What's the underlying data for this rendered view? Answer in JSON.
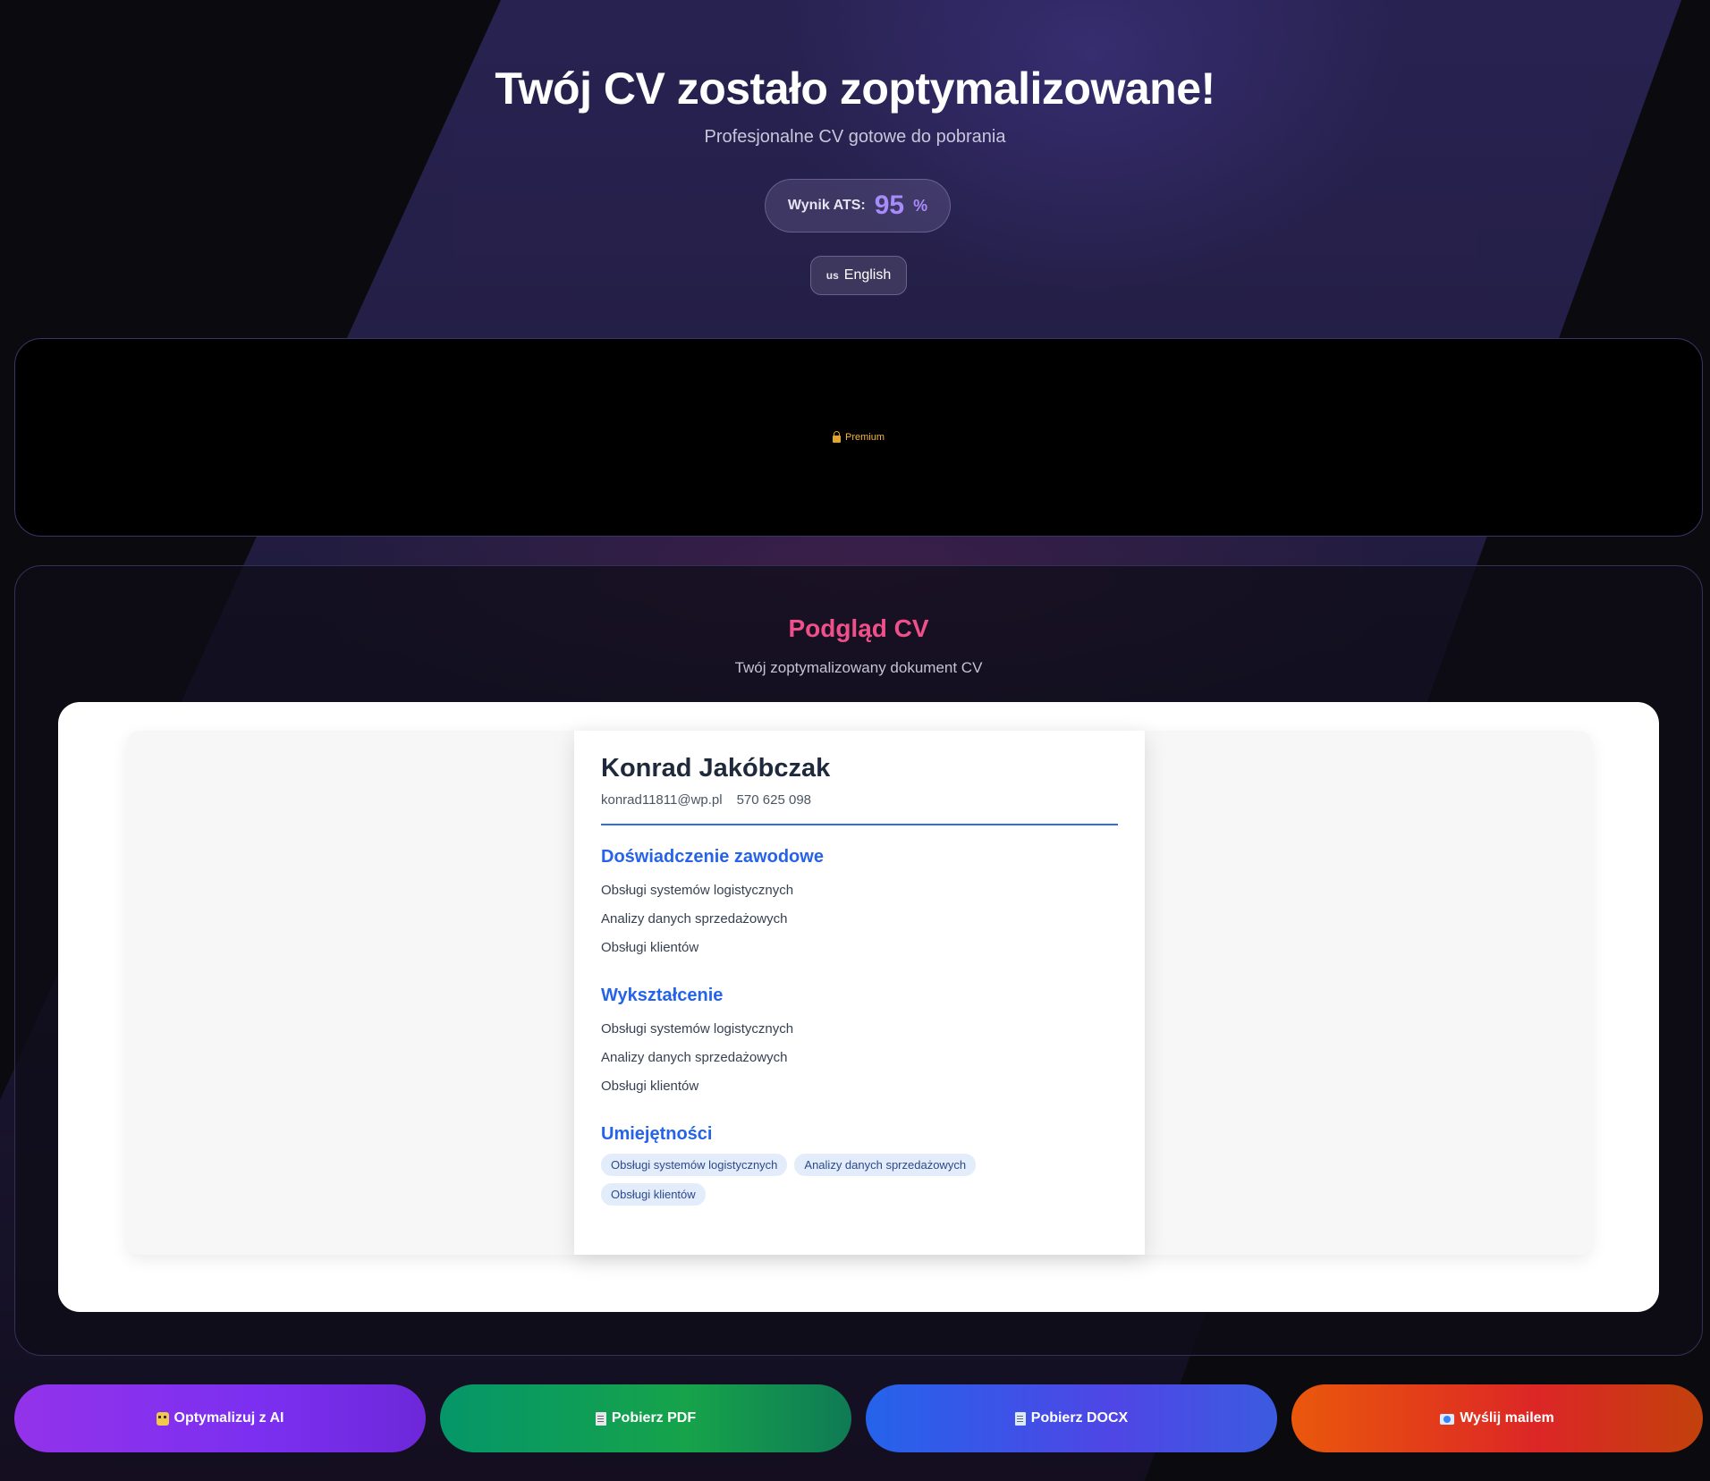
{
  "header": {
    "title": "Twój CV zostało zoptymalizowane!",
    "subtitle": "Profesjonalne CV gotowe do pobrania",
    "ats": {
      "label": "Wynik ATS:",
      "value": "95",
      "unit": "%"
    },
    "language": {
      "flag": "us",
      "label": "English"
    }
  },
  "premium": {
    "label": "Premium",
    "icon": "lock-icon"
  },
  "preview": {
    "title": "Podgląd CV",
    "subtitle": "Twój zoptymalizowany dokument CV",
    "cv": {
      "name": "Konrad Jakóbczak",
      "email": "konrad11811@wp.pl",
      "phone": "570 625 098",
      "sections": [
        {
          "title": "Doświadczenie zawodowe",
          "lines": [
            "Obsługi systemów logistycznych",
            "Analizy danych sprzedażowych",
            "Obsługi klientów"
          ]
        },
        {
          "title": "Wykształcenie",
          "lines": [
            "Obsługi systemów logistycznych",
            "Analizy danych sprzedażowych",
            "Obsługi klientów"
          ]
        }
      ],
      "skills": {
        "title": "Umiejętności",
        "tags": [
          "Obsługi systemów logistycznych",
          "Analizy danych sprzedażowych",
          "Obsługi klientów"
        ]
      }
    }
  },
  "actions": [
    {
      "label": "Optymalizuj z AI",
      "icon": "robot-icon",
      "color": "#9333ea"
    },
    {
      "label": "Pobierz PDF",
      "icon": "document-icon",
      "color": "#16a34a"
    },
    {
      "label": "Pobierz DOCX",
      "icon": "document-icon",
      "color": "#4f46e5"
    },
    {
      "label": "Wyślij mailem",
      "icon": "mail-icon",
      "color": "#dc2626"
    }
  ],
  "colors": {
    "accent": "#a78bfa",
    "preview_title": "#f0508a",
    "cv_heading": "#2563eb"
  }
}
